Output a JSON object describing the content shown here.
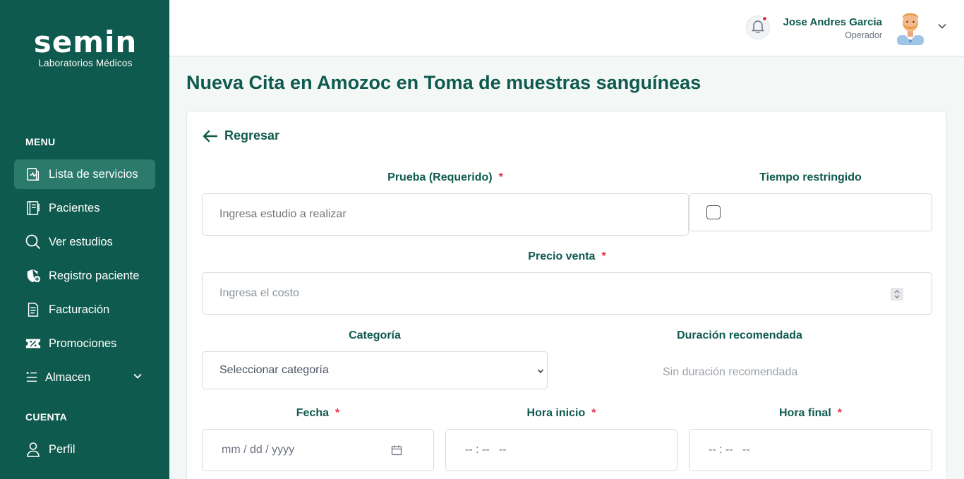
{
  "sidebar": {
    "logo_text": "semin",
    "logo_sub": "Laboratorios Médicos",
    "menu_label": "MENU",
    "account_label": "CUENTA",
    "items": [
      {
        "label": "Lista de servicios",
        "icon": "service-list-icon"
      },
      {
        "label": "Pacientes",
        "icon": "patients-icon"
      },
      {
        "label": "Ver estudios",
        "icon": "search-icon"
      },
      {
        "label": "Registro paciente",
        "icon": "shield-plus-icon"
      },
      {
        "label": "Facturación",
        "icon": "invoice-icon"
      },
      {
        "label": "Promociones",
        "icon": "discount-icon"
      },
      {
        "label": "Almacen",
        "icon": "list-icon"
      }
    ],
    "account_items": [
      {
        "label": "Perfil",
        "icon": "user-icon"
      }
    ]
  },
  "header": {
    "user_name": "Jose Andres Garcia",
    "user_role": "Operador"
  },
  "page": {
    "title": "Nueva Cita en Amozoc en Toma de muestras sanguíneas"
  },
  "form": {
    "back_label": "Regresar",
    "prueba_label": "Prueba (Requerido)",
    "prueba_placeholder": "Ingresa estudio a realizar",
    "tiempo_label": "Tiempo restringido",
    "precio_label": "Precio venta",
    "precio_placeholder": "Ingresa el costo",
    "categoria_label": "Categoría",
    "categoria_value": "Seleccionar categoría",
    "duracion_label": "Duración recomendada",
    "duracion_value": "Sin duración recomendada",
    "fecha_label": "Fecha",
    "fecha_placeholder": "mm / dd / yyyy",
    "hora_inicio_label": "Hora inicio",
    "hora_inicio_placeholder": "-- : --   --",
    "hora_final_label": "Hora final",
    "hora_final_placeholder": "-- : --   --",
    "required_mark": "*"
  },
  "colors": {
    "sidebar_bg": "#0f5a4e",
    "active_bg": "#2b7a6c",
    "accent": "#0f5a4e",
    "required": "#e0334a"
  }
}
